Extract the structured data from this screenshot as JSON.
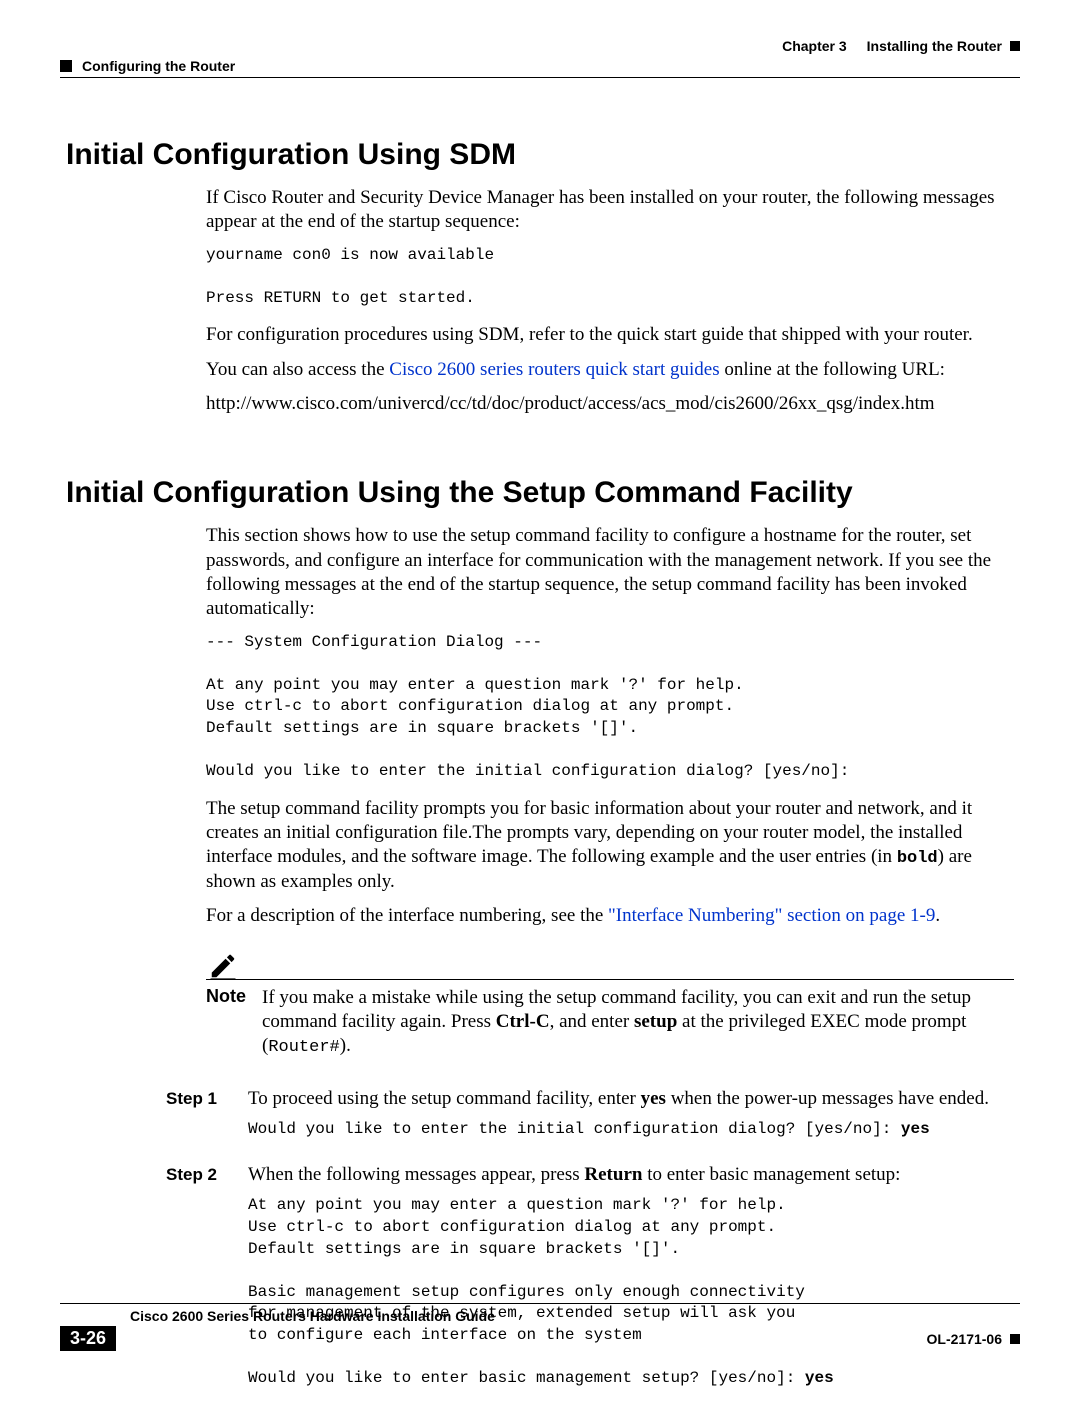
{
  "header": {
    "chapter_prefix": "Chapter 3",
    "chapter_title": "Installing the Router",
    "section_running": "Configuring the Router"
  },
  "section1": {
    "heading": "Initial Configuration Using SDM",
    "p1": "If Cisco Router and Security Device Manager has been installed on your router, the following messages appear at the end of the startup sequence:",
    "screen1": "yourname con0 is now available\n\nPress RETURN to get started.",
    "p2": "For configuration procedures using SDM, refer to the quick start guide that shipped with your router.",
    "p3_pre": "You can also access the ",
    "p3_link": "Cisco 2600 series routers quick start guides",
    "p3_post": " online at the following URL:",
    "url": "http://www.cisco.com/univercd/cc/td/doc/product/access/acs_mod/cis2600/26xx_qsg/index.htm"
  },
  "section2": {
    "heading": "Initial Configuration Using the Setup Command Facility",
    "p1": "This section shows how to use the setup command facility to configure a hostname for the router, set passwords, and configure an interface for communication with the management network. If you see the following messages at the end of the startup sequence, the setup command facility has been invoked automatically:",
    "screen1": "--- System Configuration Dialog ---\n\nAt any point you may enter a question mark '?' for help.\nUse ctrl-c to abort configuration dialog at any prompt.\nDefault settings are in square brackets '[]'.\n\nWould you like to enter the initial configuration dialog? [yes/no]:",
    "p2_pre": "The setup command facility prompts you for basic information about your router and network, and it creates an initial configuration file.The prompts vary, depending on your router model, the installed interface modules, and the software image. The following example and the user entries (in ",
    "p2_bold_inline": "bold",
    "p2_post": ") are shown as examples only.",
    "p3_pre": "For a description of the interface numbering, see the ",
    "p3_link": "\"Interface Numbering\" section on page 1-9",
    "p3_post": "."
  },
  "note": {
    "label": "Note",
    "text_pre": "If you make a mistake while using the setup command facility, you can exit and run the setup command facility again. Press ",
    "ctrlc": "Ctrl-C",
    "text_mid": ", and enter ",
    "setup": "setup",
    "text_after": " at the privileged EXEC mode prompt (",
    "prompt": "Router#",
    "text_end": ")."
  },
  "steps": {
    "s1_label": "Step 1",
    "s1_text_pre": "To proceed using the setup command facility, enter ",
    "s1_yes": "yes",
    "s1_text_post": " when the power-up messages have ended.",
    "s1_screen_pre": "Would you like to enter the initial configuration dialog? [yes/no]: ",
    "s1_screen_bold": "yes",
    "s2_label": "Step 2",
    "s2_text_pre": "When the following messages appear, press ",
    "s2_return": "Return",
    "s2_text_post": " to enter basic management setup:",
    "s2_screen_pre": "At any point you may enter a question mark '?' for help.\nUse ctrl-c to abort configuration dialog at any prompt.\nDefault settings are in square brackets '[]'.\n\nBasic management setup configures only enough connectivity\nfor management of the system, extended setup will ask you\nto configure each interface on the system\n\nWould you like to enter basic management setup? [yes/no]: ",
    "s2_screen_bold": "yes"
  },
  "footer": {
    "book_title": "Cisco 2600 Series Routers Hardware Installation Guide",
    "page_number": "3-26",
    "doc_number": "OL-2171-06"
  }
}
